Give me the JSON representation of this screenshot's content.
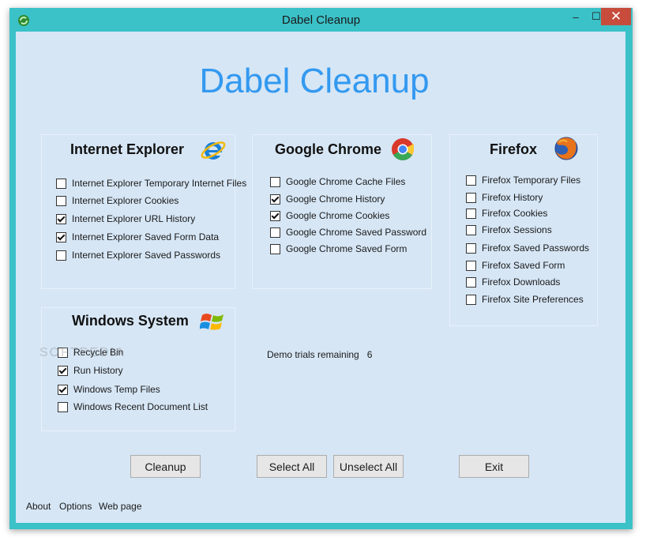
{
  "window": {
    "title": "Dabel Cleanup",
    "close_glyph": "✕",
    "min_glyph": "–",
    "max_glyph": "☐"
  },
  "app": {
    "heading": "Dabel Cleanup"
  },
  "groups": {
    "ie": {
      "title": "Internet Explorer",
      "icon": "internet-explorer-icon",
      "items": [
        {
          "label": "Internet Explorer Temporary Internet Files",
          "checked": false
        },
        {
          "label": "Internet Explorer Cookies",
          "checked": false
        },
        {
          "label": "Internet Explorer URL History",
          "checked": true
        },
        {
          "label": "Internet Explorer Saved Form Data",
          "checked": true
        },
        {
          "label": "Internet Explorer Saved Passwords",
          "checked": false
        }
      ]
    },
    "chrome": {
      "title": "Google Chrome",
      "icon": "google-chrome-icon",
      "items": [
        {
          "label": "Google Chrome Cache Files",
          "checked": false
        },
        {
          "label": "Google Chrome History",
          "checked": true
        },
        {
          "label": "Google Chrome Cookies",
          "checked": true
        },
        {
          "label": "Google Chrome Saved Password",
          "checked": false
        },
        {
          "label": "Google Chrome Saved Form",
          "checked": false
        }
      ]
    },
    "firefox": {
      "title": "Firefox",
      "icon": "firefox-icon",
      "items": [
        {
          "label": "Firefox Temporary Files",
          "checked": false
        },
        {
          "label": "Firefox History",
          "checked": false
        },
        {
          "label": "Firefox Cookies",
          "checked": false
        },
        {
          "label": "Firefox Sessions",
          "checked": false
        },
        {
          "label": "Firefox Saved Passwords",
          "checked": false
        },
        {
          "label": "Firefox Saved Form",
          "checked": false
        },
        {
          "label": "Firefox Downloads",
          "checked": false
        },
        {
          "label": "Firefox Site Preferences",
          "checked": false
        }
      ]
    },
    "windows": {
      "title": "Windows System",
      "icon": "windows-logo-icon",
      "items": [
        {
          "label": "Recycle Bin",
          "checked": false
        },
        {
          "label": "Run History",
          "checked": true
        },
        {
          "label": "Windows Temp Files",
          "checked": true
        },
        {
          "label": "Windows Recent Document List",
          "checked": false
        }
      ]
    }
  },
  "demo": {
    "label": "Demo trials remaining",
    "count": "6"
  },
  "buttons": {
    "cleanup": "Cleanup",
    "select_all": "Select All",
    "unselect_all": "Unselect All",
    "exit": "Exit"
  },
  "links": {
    "about": "About",
    "options": "Options",
    "web_page": "Web page"
  },
  "watermark": "SOFTPEDIA",
  "colors": {
    "frame": "#3bc1c8",
    "client": "#d6e6f5",
    "heading": "#3399f0",
    "close": "#c74c3c"
  }
}
